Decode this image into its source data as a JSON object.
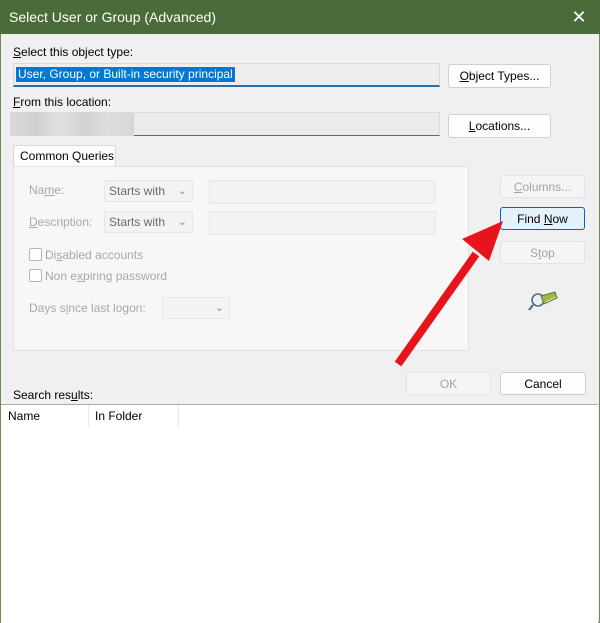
{
  "window": {
    "title": "Select User or Group (Advanced)",
    "close_glyph": "✕"
  },
  "object_type": {
    "label_first": "S",
    "label_rest": "elect this object type:",
    "value": "User, Group, or Built-in security principal",
    "button_first": "O",
    "button_rest": "bject Types..."
  },
  "location": {
    "label_first": "F",
    "label_rest": "rom this location:",
    "button_first": "L",
    "button_rest": "ocations..."
  },
  "common_queries": {
    "tab_label": "Common Queries",
    "name_label_first": "Na",
    "name_label_u": "m",
    "name_label_rest": "e:",
    "name_mode": "Starts with",
    "description_label_first": "",
    "description_label_u": "D",
    "description_label_rest": "escription:",
    "description_mode": "Starts with",
    "disabled_accounts_first": "Di",
    "disabled_accounts_u": "s",
    "disabled_accounts_rest": "abled accounts",
    "non_expiring_first": "Non e",
    "non_expiring_u": "x",
    "non_expiring_rest": "piring password",
    "days_label_first": "Days s",
    "days_label_u": "i",
    "days_label_rest": "nce last logon:"
  },
  "side_buttons": {
    "columns_first": "",
    "columns_u": "C",
    "columns_rest": "olumns...",
    "find_now_first": "Find ",
    "find_now_u": "N",
    "find_now_rest": "ow",
    "stop_first": "S",
    "stop_u": "t",
    "stop_rest": "op"
  },
  "actions": {
    "ok": "OK",
    "cancel": "Cancel"
  },
  "search_results": {
    "label_first": "Search res",
    "label_u": "u",
    "label_rest": "lts:",
    "columns": [
      "Name",
      "In Folder"
    ]
  },
  "annotation": {
    "arrow_color": "#e8141b"
  },
  "icons": {
    "search_icon": "magnifier-flashlight-icon"
  }
}
